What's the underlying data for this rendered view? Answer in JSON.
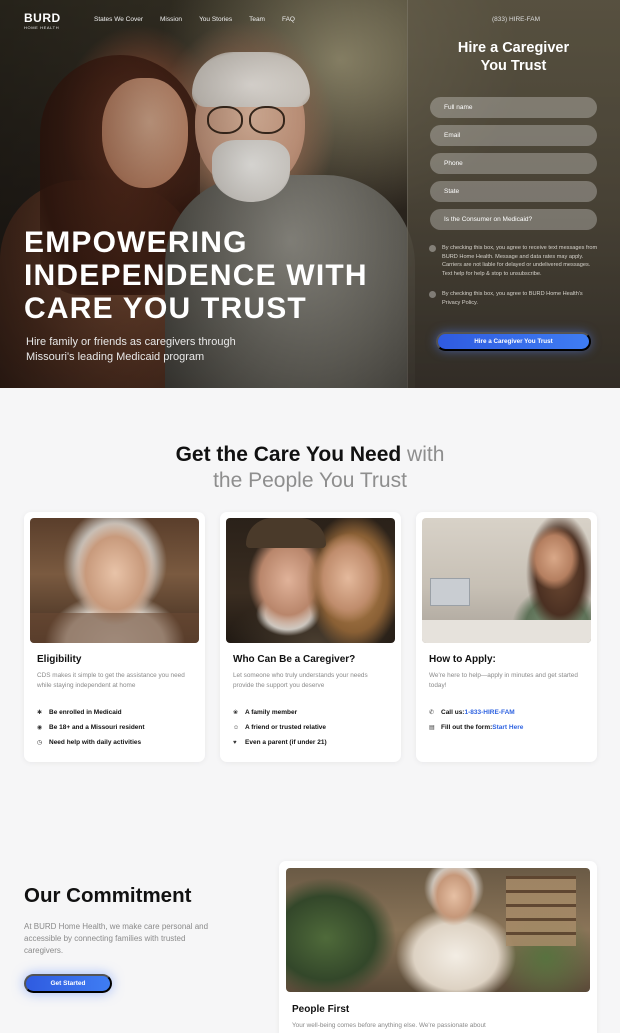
{
  "nav": {
    "logo_main": "BURD",
    "logo_sub": "HOME HEALTH",
    "links": [
      "States We Cover",
      "Mission",
      "You Stories",
      "Team",
      "FAQ"
    ],
    "phone": "(833) HIRE-FAM"
  },
  "hero": {
    "title_lines": [
      "EMPOWERING",
      "INDEPENDENCE WITH",
      "CARE YOU TRUST"
    ],
    "subtitle": "Hire family or friends as caregivers through Missouri's leading Medicaid program"
  },
  "form": {
    "title_lines": [
      "Hire a Caregiver",
      "You Trust"
    ],
    "fields": [
      {
        "placeholder": "Full name"
      },
      {
        "placeholder": "Email"
      },
      {
        "placeholder": "Phone"
      },
      {
        "placeholder": "State"
      },
      {
        "placeholder": "Is the Consumer on Medicaid?"
      }
    ],
    "consent_sms": "By checking this box, you agree to receive text messages from BURD Home Health. Message and data rates may apply. Carriers are not liable for delayed or undelivered messages. Text help for help & stop to unsubscribe.",
    "consent_privacy": "By checking this box, you agree to BURD Home Health's Privacy Policy.",
    "submit_label": "Hire a Caregiver You Trust"
  },
  "section2": {
    "title_dark_1": "Get the Care You Need",
    "title_light_1": " with",
    "title_light_2": "the People You Trust",
    "cards": [
      {
        "title": "Eligibility",
        "description": "CDS makes it simple to get the assistance you need while staying independent at home",
        "items": [
          {
            "icon": "asterisk-icon",
            "glyph": "✱",
            "text": "Be enrolled in Medicaid"
          },
          {
            "icon": "location-icon",
            "glyph": "◉",
            "text": "Be 18+ and a Missouri resident"
          },
          {
            "icon": "clock-icon",
            "glyph": "◷",
            "text": "Need help with daily activities"
          }
        ]
      },
      {
        "title": "Who Can Be a Caregiver?",
        "description": "Let someone who truly understands your needs provide the support you deserve",
        "items": [
          {
            "icon": "family-icon",
            "glyph": "❀",
            "text": "A family member"
          },
          {
            "icon": "friend-icon",
            "glyph": "☺",
            "text": "A friend or trusted relative"
          },
          {
            "icon": "thumbs-up-icon",
            "glyph": "♥",
            "text": "Even a parent (if under 21)"
          }
        ]
      },
      {
        "title": "How to Apply:",
        "description": "We're here to help—apply in minutes and get started today!",
        "call_label": "Call us: ",
        "call_link": "1-833-HIRE-FAM",
        "form_label": "Fill out the form: ",
        "form_link": "Start Here",
        "call_glyph": "✆",
        "form_glyph": "▤"
      }
    ]
  },
  "section3": {
    "title": "Our Commitment",
    "text": "At BURD Home Health, we make care personal and accessible by connecting families with trusted caregivers.",
    "button_label": "Get Started",
    "card_title": "People First",
    "card_text": "Your well-being comes before anything else. We're passionate about"
  },
  "colors": {
    "accent": "#2f5be0",
    "link": "#2f63e0",
    "page_bg": "#f6f6f7"
  }
}
